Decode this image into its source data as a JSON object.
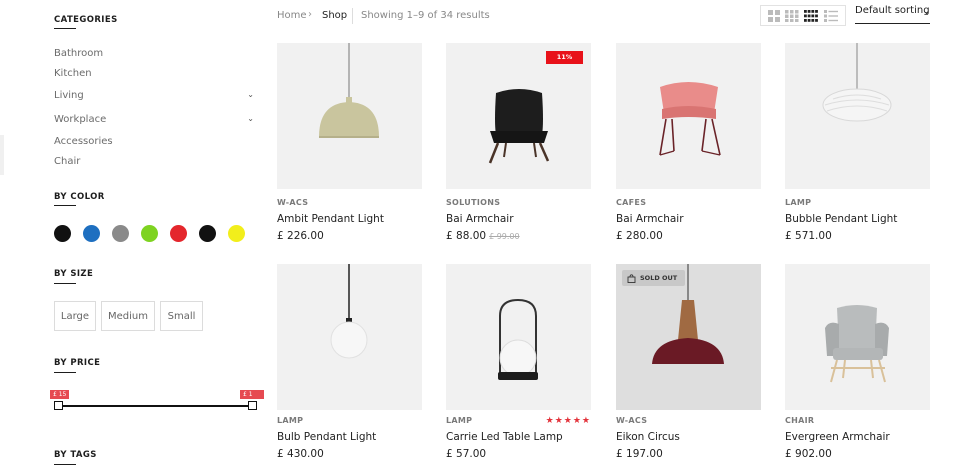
{
  "sidebar": {
    "categories_heading": "CATEGORIES",
    "categories": [
      {
        "label": "Bathroom"
      },
      {
        "label": "Kitchen"
      },
      {
        "label": "Living"
      },
      {
        "label": "Workplace"
      },
      {
        "label": "Accessories"
      },
      {
        "label": "Chair"
      }
    ],
    "color_heading": "BY COLOR",
    "colors": [
      "#111111",
      "#1e6fc0",
      "#8a8a8a",
      "#7ed321",
      "#e4262c",
      "#111111",
      "#f2ee1b"
    ],
    "size_heading": "BY SIZE",
    "sizes": [
      "Large",
      "Medium",
      "Small"
    ],
    "price_heading": "BY PRICE",
    "price_min": "£ 15",
    "price_max": "£ 1 888",
    "tags_heading": "BY TAGS"
  },
  "topbar": {
    "breadcrumb_home": "Home",
    "breadcrumb_sep": "›",
    "breadcrumb_current": "Shop",
    "results": "Showing 1–9 of 34 results",
    "sort_label": "Default sorting",
    "sort_chevron": "⌄"
  },
  "products": [
    {
      "category": "W-ACS",
      "name": "Ambit Pendant Light",
      "price": "£ 226.00"
    },
    {
      "category": "SOLUTIONS",
      "name": "Bai Armchair",
      "price": "£ 88.00",
      "old_price": "£ 99.00",
      "badge": "11%"
    },
    {
      "category": "CAFES",
      "name": "Bai Armchair",
      "price": "£ 280.00"
    },
    {
      "category": "LAMP",
      "name": "Bubble Pendant Light",
      "price": "£ 571.00"
    },
    {
      "category": "LAMP",
      "name": "Bulb Pendant Light",
      "price": "£ 430.00"
    },
    {
      "category": "LAMP",
      "name": "Carrie Led Table Lamp",
      "price": "£ 57.00",
      "rating": 4.5,
      "stars": "★★★★★"
    },
    {
      "category": "W-ACS",
      "name": "Eikon Circus",
      "price": "£ 197.00",
      "badge": "SOLD OUT"
    },
    {
      "category": "CHAIR",
      "name": "Evergreen Armchair",
      "price": "£ 902.00"
    }
  ],
  "icons": {
    "chevron": "⌄"
  }
}
